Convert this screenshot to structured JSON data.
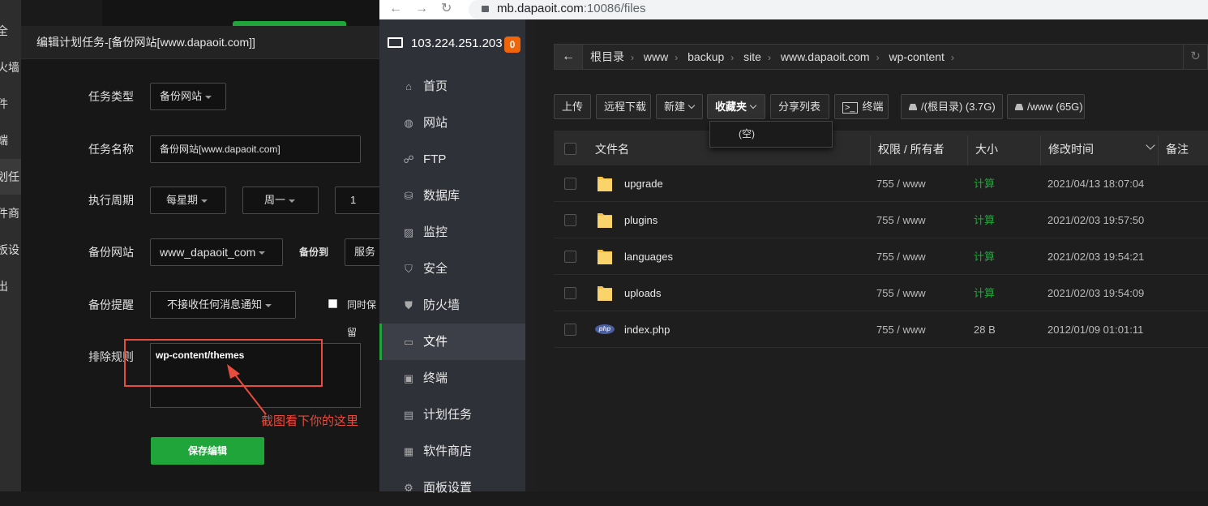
{
  "left_nav": {
    "items": [
      "全",
      "火墙",
      "件",
      "端",
      "划任",
      "件商",
      "板设",
      "出"
    ]
  },
  "modal": {
    "title": "编辑计划任务-[备份网站[www.dapaoit.com]]",
    "task_type_label": "任务类型",
    "task_type_value": "备份网站",
    "task_name_label": "任务名称",
    "task_name_value": "备份网站[www.dapaoit.com]",
    "period_label": "执行周期",
    "period_value": "每星期",
    "weekday_value": "周一",
    "hour_value": "1",
    "site_label": "备份网站",
    "site_value": "www_dapaoit_com",
    "backup_to_label": "备份到",
    "backup_to_value": "服务",
    "notify_label": "备份提醒",
    "notify_value": "不接收任何消息通知",
    "keep_label": "同时保留",
    "exclude_label": "排除规则",
    "exclude_value": "wp-content/themes",
    "save_label": "保存编辑"
  },
  "annotation": {
    "text": "截图看下你的这里",
    "color": "#e74c3c"
  },
  "browser": {
    "url_host": "mb.dapaoit.com",
    "url_path": ":10086/files"
  },
  "sidebar": {
    "server_ip": "103.224.251.203",
    "badge": "0",
    "items": [
      {
        "label": "首页",
        "icon": "home-icon"
      },
      {
        "label": "网站",
        "icon": "globe-icon"
      },
      {
        "label": "FTP",
        "icon": "ftp-icon"
      },
      {
        "label": "数据库",
        "icon": "database-icon"
      },
      {
        "label": "监控",
        "icon": "monitor-chart-icon"
      },
      {
        "label": "安全",
        "icon": "shield-icon"
      },
      {
        "label": "防火墙",
        "icon": "firewall-icon"
      },
      {
        "label": "文件",
        "icon": "folder-icon"
      },
      {
        "label": "终端",
        "icon": "terminal-icon"
      },
      {
        "label": "计划任务",
        "icon": "calendar-icon"
      },
      {
        "label": "软件商店",
        "icon": "apps-icon"
      },
      {
        "label": "面板设置",
        "icon": "gear-icon"
      }
    ],
    "active_index": 7,
    "accent_color": "#20a53a"
  },
  "files": {
    "breadcrumb": [
      "根目录",
      "www",
      "backup",
      "site",
      "www.dapaoit.com",
      "wp-content"
    ],
    "toolbar": {
      "upload": "上传",
      "remote_download": "远程下载",
      "new": "新建",
      "bookmarks": "收藏夹",
      "share_list": "分享列表",
      "terminal": "终端",
      "disk_root": "/(根目录) (3.7G)",
      "disk_www": "/www (65G)"
    },
    "bookmarks_dropdown": "(空)",
    "columns": {
      "name": "文件名",
      "perm": "权限 / 所有者",
      "size": "大小",
      "mtime": "修改时间",
      "note": "备注"
    },
    "rows": [
      {
        "type": "folder",
        "name": "upgrade",
        "perm": "755 / www",
        "size": "计算",
        "mtime": "2021/04/13 18:07:04"
      },
      {
        "type": "folder",
        "name": "plugins",
        "perm": "755 / www",
        "size": "计算",
        "mtime": "2021/02/03 19:57:50"
      },
      {
        "type": "folder",
        "name": "languages",
        "perm": "755 / www",
        "size": "计算",
        "mtime": "2021/02/03 19:54:21"
      },
      {
        "type": "folder",
        "name": "uploads",
        "perm": "755 / www",
        "size": "计算",
        "mtime": "2021/02/03 19:54:09"
      },
      {
        "type": "php",
        "name": "index.php",
        "perm": "755 / www",
        "size": "28 B",
        "mtime": "2012/01/09 01:01:11"
      }
    ]
  }
}
